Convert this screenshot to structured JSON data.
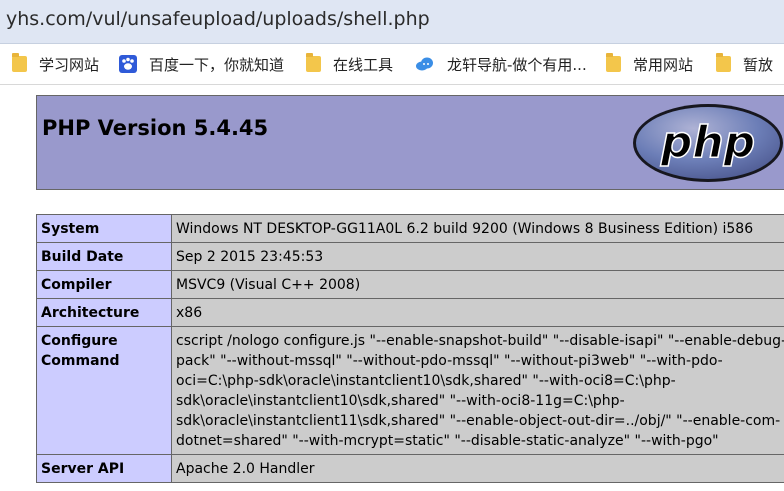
{
  "browser": {
    "url": "yhs.com/vul/unsafeupload/uploads/shell.php"
  },
  "bookmarks": [
    {
      "label": "学习网站",
      "icon": "folder-icon"
    },
    {
      "label": "百度一下，你就知道",
      "icon": "baidu-paw-icon"
    },
    {
      "label": "在线工具",
      "icon": "folder-icon"
    },
    {
      "label": "龙轩导航-做个有用...",
      "icon": "cloud-icon"
    },
    {
      "label": "常用网站",
      "icon": "folder-icon"
    },
    {
      "label": "暂放",
      "icon": "folder-icon"
    }
  ],
  "phpinfo": {
    "title": "PHP Version 5.4.45",
    "logo_text": "php",
    "rows": [
      {
        "key": "System",
        "value": "Windows NT DESKTOP-GG11A0L 6.2 build 9200 (Windows 8 Business Edition) i586"
      },
      {
        "key": "Build Date",
        "value": "Sep 2 2015 23:45:53"
      },
      {
        "key": "Compiler",
        "value": "MSVC9 (Visual C++ 2008)"
      },
      {
        "key": "Architecture",
        "value": "x86"
      },
      {
        "key": "Configure Command",
        "value": "cscript /nologo configure.js \"--enable-snapshot-build\" \"--disable-isapi\" \"--enable-debug-pack\" \"--without-mssql\" \"--without-pdo-mssql\" \"--without-pi3web\" \"--with-pdo-oci=C:\\php-sdk\\oracle\\instantclient10\\sdk,shared\" \"--with-oci8=C:\\php-sdk\\oracle\\instantclient10\\sdk,shared\" \"--with-oci8-11g=C:\\php-sdk\\oracle\\instantclient11\\sdk,shared\" \"--enable-object-out-dir=../obj/\" \"--enable-com-dotnet=shared\" \"--with-mcrypt=static\" \"--disable-static-analyze\" \"--with-pgo\""
      },
      {
        "key": "Server API",
        "value": "Apache 2.0 Handler"
      }
    ]
  },
  "colors": {
    "header_bg": "#9999cc",
    "key_cell_bg": "#ccccff",
    "value_cell_bg": "#cccccc",
    "urlbar_bg": "#dfe6f3"
  }
}
